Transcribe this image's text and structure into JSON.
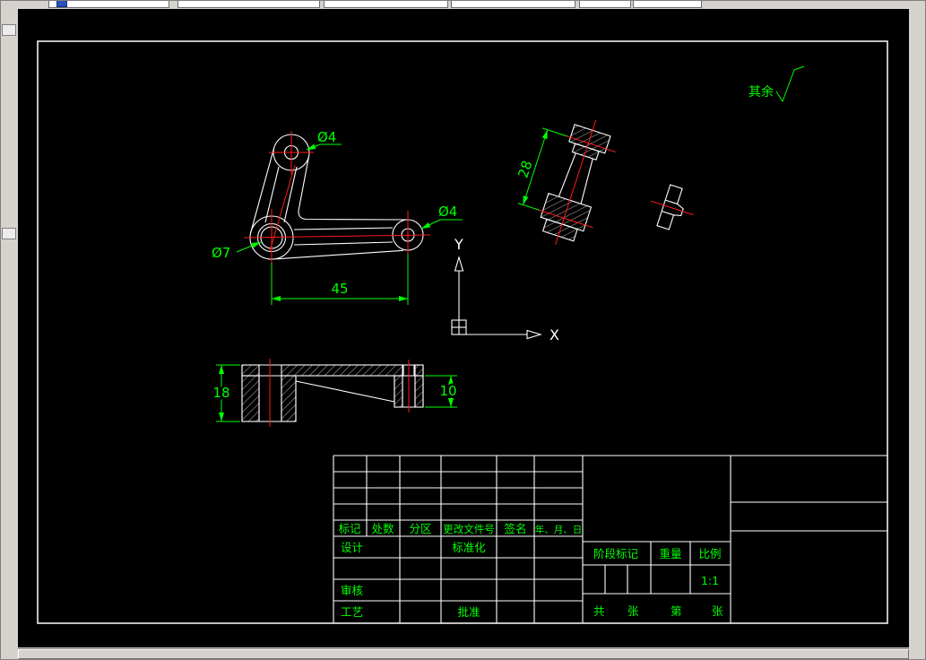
{
  "window": {
    "chrome_color": "#d6d3ce"
  },
  "drawing": {
    "colors": {
      "background": "#000000",
      "lines": "#ffffff",
      "dimensions": "#00ff00",
      "centerlines": "#ff0000"
    },
    "axis": {
      "x": "X",
      "y": "Y"
    },
    "surface_note": "其余",
    "dims": {
      "top_hole": "Ø4",
      "right_hole": "Ø4",
      "big_hole": "Ø7",
      "arm_length": "45",
      "boss_spacing": "28",
      "left_height": "18",
      "right_height": "10"
    }
  },
  "title_block": {
    "header": [
      "标记",
      "处数",
      "分区",
      "更改文件号",
      "签名",
      "年、月、日"
    ],
    "design": "设计",
    "standardization": "标准化",
    "check": "审核",
    "process": "工艺",
    "approve": "批准",
    "stage_mark": "阶段标记",
    "weight": "重量",
    "scale_label": "比例",
    "scale_value": "1:1",
    "total_label": "共",
    "total_sheets_label": "张",
    "sheet_no_label": "第",
    "sheet_label": "张"
  }
}
